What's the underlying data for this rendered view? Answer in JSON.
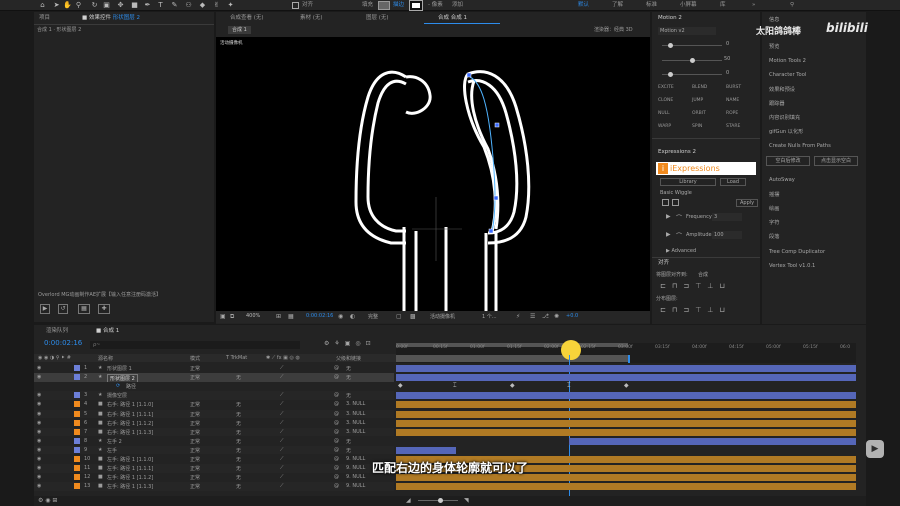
{
  "toolbar": {
    "fill_label": "填充",
    "stroke_label": "描边",
    "stroke_px": "- 像素",
    "add_label": "添加",
    "snap_label": "对齐",
    "workspaces": [
      "默认",
      "了解",
      "标准",
      "小屏幕",
      "库"
    ],
    "active_workspace": "默认"
  },
  "project_panel": {
    "tab_project": "项目",
    "tab_effects": "效果控件",
    "effects_target": "形状图层 2",
    "breadcrumb": "合成 1 · 形状图层 2"
  },
  "viewer": {
    "tabs": [
      "合成查看 (无)",
      "素材 (无)",
      "图层 (无)"
    ],
    "comp_tab": "合成 合成 1",
    "sub_tab": "合成 1",
    "renderer": "渲染器：经典 3D",
    "camera_label": "活动摄像机",
    "zoom": "400%",
    "timecode": "0:00:02:16",
    "quality": "完整",
    "view_camera": "活动摄像机",
    "views": "1 个...",
    "exposure": "+0.0"
  },
  "plugin_panel": {
    "title": "Overlord  MG动画制作AE扩展【输入任意注册码激活】"
  },
  "motion2": {
    "title": "Motion 2",
    "version": "Motion v2",
    "val1": "0",
    "val2": "50",
    "val3": "0",
    "buttons": [
      "EXCITE",
      "BLEND",
      "BURST",
      "CLONE",
      "JUMP",
      "NAME",
      "NULL",
      "ORBIT",
      "ROPE",
      "WARP",
      "SPIN",
      "STARE"
    ],
    "expr_tab": "Expressions 2",
    "iexpr": "iExpressions",
    "lib_tab": "Library",
    "load_btn": "Load",
    "basic": "Basic Wiggle",
    "apply": "Apply",
    "frequency_label": "Frequency",
    "frequency_value": "3",
    "amplitude_label": "Amplitude",
    "amplitude_value": "100",
    "advanced": "Advanced"
  },
  "align": {
    "title": "对齐",
    "align_to_label": "将图层对齐到:",
    "align_to_value": "合成",
    "distribute": "分布图层:"
  },
  "brand": {
    "name": "太阳鸽鸽棒",
    "logo": "bilibili"
  },
  "scripts": {
    "items": [
      "信息",
      "预览",
      "Motion Tools 2",
      "Character Tool",
      "效果和预设",
      "跟踪器",
      "内容识别填充",
      "gifGun 以化形",
      "Create Nulls From Paths",
      "AutoSway",
      "摇摆",
      "绘画",
      "字符",
      "段落",
      "Tree Comp Duplicator",
      "Vertex Tool v1.0.1"
    ],
    "btn_a": "空白后修改",
    "btn_b": "点击显示空白"
  },
  "timeline": {
    "tab_queue": "渲染队列",
    "tab_comp": "合成 1",
    "timecode": "0:00:02:16",
    "search_placeholder": "ρ~",
    "col_source": "源名称",
    "col_mode": "模式",
    "col_t": "T TrkMat",
    "col_parent": "父级和链接",
    "ruler_labels": [
      "0:00f",
      "00:15f",
      "01:00f",
      "01:15f",
      "02:00f",
      "02:15f",
      "03:00f",
      "03:15f",
      "04:00f",
      "04:15f",
      "05:00f",
      "05:15f",
      "06:0"
    ],
    "layers": [
      {
        "num": "1",
        "name": "形状图层 1",
        "mode": "正常",
        "trk": "",
        "parent": "无",
        "color": "#6c7fd8",
        "star": true
      },
      {
        "num": "2",
        "name": "形状图层 2",
        "mode": "正常",
        "trk": "无",
        "parent": "无",
        "color": "#6c7fd8",
        "star": true
      },
      {
        "num": "",
        "name": "路径",
        "mode": "",
        "trk": "",
        "parent": "",
        "color": "",
        "star": false
      },
      {
        "num": "3",
        "name": "摄像空层",
        "mode": "",
        "trk": "",
        "parent": "无",
        "color": "#6c7fd8",
        "star": true
      },
      {
        "num": "4",
        "name": "右手: 路径 1 [1.1.0]",
        "mode": "正常",
        "trk": "无",
        "parent": "3. NULL",
        "color": "#f08a1e",
        "star": false
      },
      {
        "num": "5",
        "name": "右手: 路径 1 [1.1.1]",
        "mode": "正常",
        "trk": "无",
        "parent": "3. NULL",
        "color": "#f08a1e",
        "star": false
      },
      {
        "num": "6",
        "name": "右手: 路径 1 [1.1.2]",
        "mode": "正常",
        "trk": "无",
        "parent": "3. NULL",
        "color": "#f08a1e",
        "star": false
      },
      {
        "num": "7",
        "name": "右手: 路径 1 [1.1.3]",
        "mode": "正常",
        "trk": "无",
        "parent": "3. NULL",
        "color": "#f08a1e",
        "star": false
      },
      {
        "num": "8",
        "name": "左手 2",
        "mode": "正常",
        "trk": "无",
        "parent": "无",
        "color": "#6c7fd8",
        "star": true
      },
      {
        "num": "9",
        "name": "左手",
        "mode": "正常",
        "trk": "无",
        "parent": "无",
        "color": "#6c7fd8",
        "star": true
      },
      {
        "num": "10",
        "name": "左手: 路径 1 [1.1.0]",
        "mode": "正常",
        "trk": "无",
        "parent": "9. NULL",
        "color": "#f08a1e",
        "star": false
      },
      {
        "num": "11",
        "name": "左手: 路径 1 [1.1.1]",
        "mode": "正常",
        "trk": "无",
        "parent": "9. NULL",
        "color": "#f08a1e",
        "star": false
      },
      {
        "num": "12",
        "name": "左手: 路径 1 [1.1.2]",
        "mode": "正常",
        "trk": "无",
        "parent": "9. NULL",
        "color": "#f08a1e",
        "star": false
      },
      {
        "num": "13",
        "name": "左手: 路径 1 [1.1.3]",
        "mode": "正常",
        "trk": "无",
        "parent": "9. NULL",
        "color": "#f08a1e",
        "star": false
      }
    ]
  },
  "subtitle": "匹配右边的身体轮廓就可以了",
  "colors": {
    "accent": "#2d8ceb",
    "playhead_marker": "#f7d33a",
    "orange_bar": "#b07a24",
    "blue_bar": "#5566b8"
  }
}
